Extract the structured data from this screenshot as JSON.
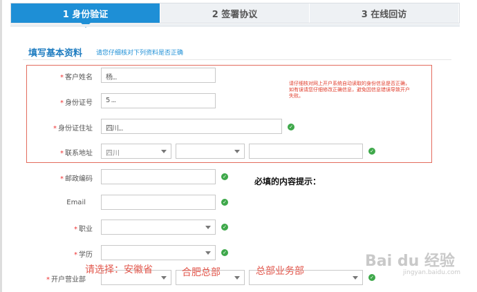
{
  "steps": [
    {
      "label": "1 身份验证"
    },
    {
      "label": "2 签署协议"
    },
    {
      "label": "3 在线回访"
    }
  ],
  "section": {
    "title": "填写基本资料",
    "hint": "请您仔细核对下列资料是否正确"
  },
  "fields": {
    "name": {
      "label": "客户姓名",
      "value": "杨..."
    },
    "id_number": {
      "label": "身份证号",
      "value": "5 ..."
    },
    "id_address": {
      "label": "身份证住址",
      "value": "四川..."
    },
    "contact_address": {
      "label": "联系地址",
      "province": "四川",
      "city": "",
      "detail": ""
    },
    "postal_code": {
      "label": "邮政编码",
      "value": ""
    },
    "email": {
      "label": "Email",
      "value": ""
    },
    "occupation": {
      "label": "职业",
      "value": ""
    },
    "education": {
      "label": "学历",
      "value": ""
    },
    "branch": {
      "label": "开户营业部",
      "value": ""
    }
  },
  "notice": "请仔细核对网上开户系统自动读取的身份信息是否正确，如有误请您仔细修改正确信息，避免因信息错误导致开户失败。",
  "tip": "必填的内容提示：",
  "annotations": {
    "select_province": "请选择：安徽省",
    "select_city": "合肥总部",
    "select_branch": "总部业务部"
  },
  "watermark": {
    "text": "Bai du 经验",
    "sub": "jingyan.baidu.com"
  }
}
